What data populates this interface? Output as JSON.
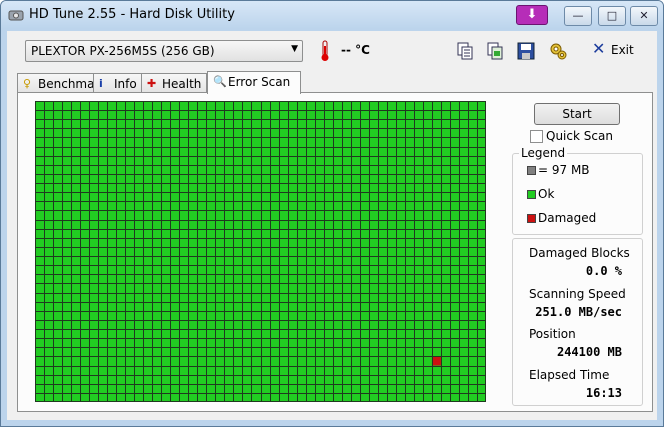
{
  "window": {
    "title": "HD Tune 2.55 - Hard Disk Utility",
    "controls": {
      "minimize": "—",
      "maximize": "□",
      "close": "✕"
    }
  },
  "toolbar": {
    "drive": "PLEXTOR PX-256M5S (256 GB)",
    "temperature": "-- °C",
    "exit_label": "Exit",
    "icons": [
      "thermometer-icon",
      "copy-info-icon",
      "copy-screenshot-icon",
      "save-icon",
      "options-icon",
      "exit-icon"
    ]
  },
  "tabs": [
    {
      "label": "Benchmark",
      "icon": "benchmark-icon",
      "active": false
    },
    {
      "label": "Info",
      "icon": "info-icon",
      "active": false
    },
    {
      "label": "Health",
      "icon": "health-icon",
      "active": false
    },
    {
      "label": "Error Scan",
      "icon": "error-scan-icon",
      "active": true
    }
  ],
  "error_scan": {
    "start_label": "Start",
    "quick_scan_label": "Quick Scan",
    "quick_scan_checked": false,
    "legend": {
      "title": "Legend",
      "block_size": "= 97 MB",
      "ok": "Ok",
      "damaged": "Damaged"
    },
    "stats": {
      "damaged_blocks_label": "Damaged Blocks",
      "damaged_blocks_value": "0.0 %",
      "scanning_speed_label": "Scanning Speed",
      "scanning_speed_value": "251.0 MB/sec",
      "position_label": "Position",
      "position_value": "244100 MB",
      "elapsed_time_label": "Elapsed Time",
      "elapsed_time_value": "16:13"
    },
    "grid": {
      "columns": 50,
      "rows": 33,
      "damaged_cells": [
        {
          "row": 28,
          "col": 44
        }
      ]
    }
  },
  "colors": {
    "ok": "#22cc22",
    "damaged": "#cc1111",
    "grid_line": "#1f3a1f",
    "block": "#808080"
  }
}
